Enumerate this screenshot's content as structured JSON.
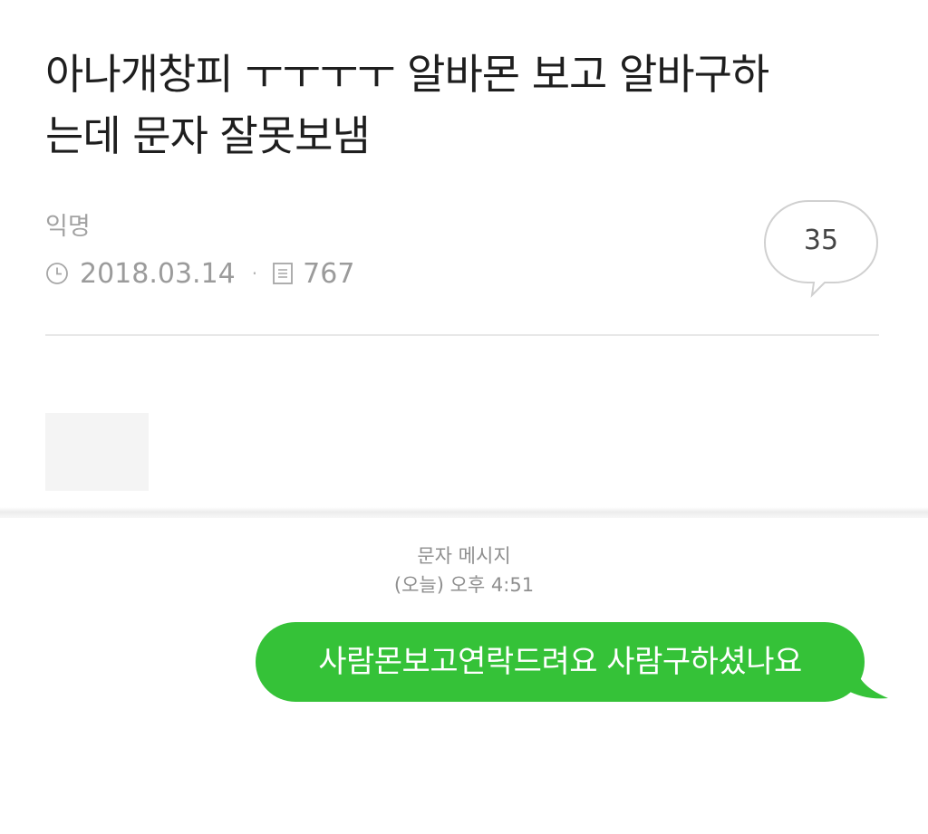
{
  "post": {
    "title_line1": "아나개창피 ㅜㅜㅜㅜ 알바몬 보고 알바구하",
    "title_line2": "는데 문자 잘못보냄",
    "author": "익명",
    "date": "2018.03.14",
    "views": "767",
    "comment_count": "35",
    "icons": {
      "date": "clock-icon",
      "views": "document-icon",
      "comments": "speech-bubble-icon"
    }
  },
  "sms": {
    "header_title": "문자 메시지",
    "header_time": "(오늘) 오후 4:51",
    "message": "사람몬보고연락드려요 사람구하셨나요",
    "bubble_color": "#35c238"
  }
}
